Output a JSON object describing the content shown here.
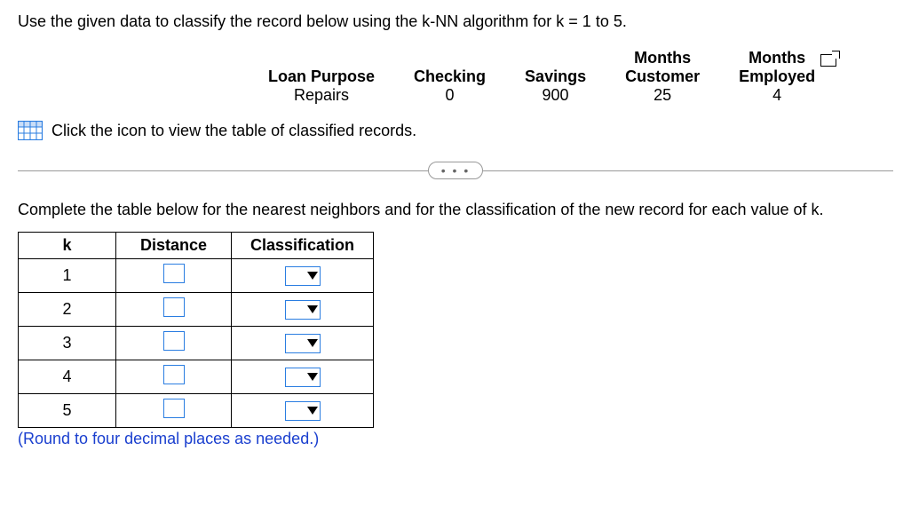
{
  "instruction": "Use the given data to classify the record below using the k-NN algorithm for k = 1 to 5.",
  "record": {
    "headers": {
      "loan_purpose": "Loan Purpose",
      "checking": "Checking",
      "savings": "Savings",
      "months_customer_l1": "Months",
      "months_customer_l2": "Customer",
      "months_employed_l1": "Months",
      "months_employed_l2": "Employed"
    },
    "values": {
      "loan_purpose": "Repairs",
      "checking": "0",
      "savings": "900",
      "months_customer": "25",
      "months_employed": "4"
    }
  },
  "link_text": "Click the icon to view the table of classified records.",
  "divider_dots": "• • •",
  "prompt": "Complete the table below for the nearest neighbors and for the classification of the new record for each value of k.",
  "knn": {
    "headers": {
      "k": "k",
      "distance": "Distance",
      "classification": "Classification"
    },
    "rows": [
      {
        "k": "1"
      },
      {
        "k": "2"
      },
      {
        "k": "3"
      },
      {
        "k": "4"
      },
      {
        "k": "5"
      }
    ]
  },
  "round_note": "(Round to four decimal places as needed.)"
}
